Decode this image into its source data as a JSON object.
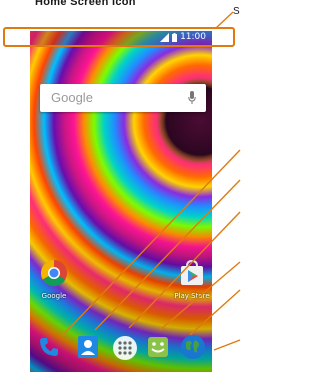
{
  "doc": {
    "title": "Home Screen Icon",
    "callout_letter": "S"
  },
  "status_bar": {
    "time": "11:00"
  },
  "search": {
    "label": "Google"
  },
  "home": {
    "apps": [
      {
        "label": "Google",
        "icon": "google-chrome-icon"
      },
      {
        "label": "Play Store",
        "icon": "play-store-icon"
      }
    ]
  },
  "dock": {
    "icons": [
      "phone-icon",
      "contacts-icon",
      "app-drawer-icon",
      "messaging-icon",
      "browser-icon"
    ]
  },
  "colors": {
    "callout_orange": "#e07a10",
    "wallpaper_primary": "#ff2d7a"
  }
}
